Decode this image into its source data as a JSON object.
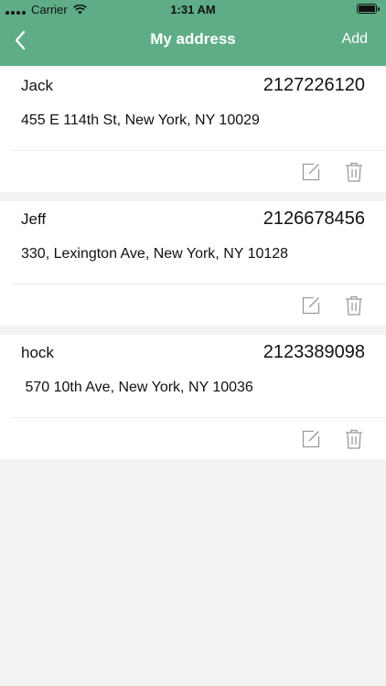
{
  "status_bar": {
    "carrier": "Carrier",
    "time": "1:31 AM"
  },
  "nav": {
    "title": "My address",
    "add_label": "Add",
    "back_icon": "chevron-left-icon"
  },
  "colors": {
    "header": "#5fad86",
    "background": "#f3f3f3",
    "icon_gray": "#9a9a9a"
  },
  "addresses": [
    {
      "name": "Jack",
      "phone": "2127226120",
      "address": "455 E 114th St, New York, NY 10029"
    },
    {
      "name": "Jeff",
      "phone": "2126678456",
      "address": "330, Lexington Ave, New York, NY 10128"
    },
    {
      "name": "hock",
      "phone": "2123389098",
      "address": " 570 10th Ave, New York, NY 10036"
    }
  ]
}
